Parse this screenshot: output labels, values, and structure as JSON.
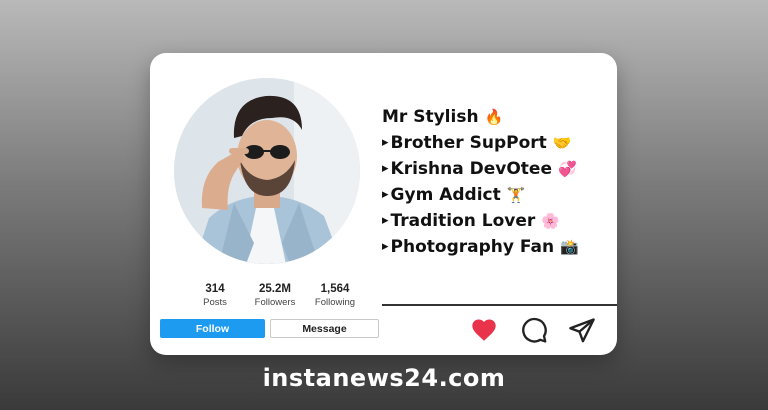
{
  "profile": {
    "stats": [
      {
        "value": "314",
        "label": "Posts"
      },
      {
        "value": "25.2M",
        "label": "Followers"
      },
      {
        "value": "1,564",
        "label": "Following"
      }
    ],
    "buttons": {
      "follow_label": "Follow",
      "message_label": "Message"
    },
    "bio": [
      {
        "bullet": "",
        "text": "Mr Stylish",
        "emoji": "🔥"
      },
      {
        "bullet": "▸",
        "text": "Brother SupPort",
        "emoji": "🤝"
      },
      {
        "bullet": "▸",
        "text": "Krishna DevOtee",
        "emoji": "💞"
      },
      {
        "bullet": "▸",
        "text": "Gym Addict",
        "emoji": "🏋"
      },
      {
        "bullet": "▸",
        "text": "Tradition Lover",
        "emoji": "🌸"
      },
      {
        "bullet": "▸",
        "text": "Photography Fan",
        "emoji": "📸"
      }
    ],
    "actions": [
      {
        "icon": "heart-icon",
        "color": "#e8334b"
      },
      {
        "icon": "comment-icon",
        "color": "#222222"
      },
      {
        "icon": "share-icon",
        "color": "#222222"
      }
    ]
  },
  "footer": {
    "site": "instanews24.com"
  },
  "colors": {
    "follow_button": "#1d9bf0",
    "heart": "#e8334b"
  }
}
